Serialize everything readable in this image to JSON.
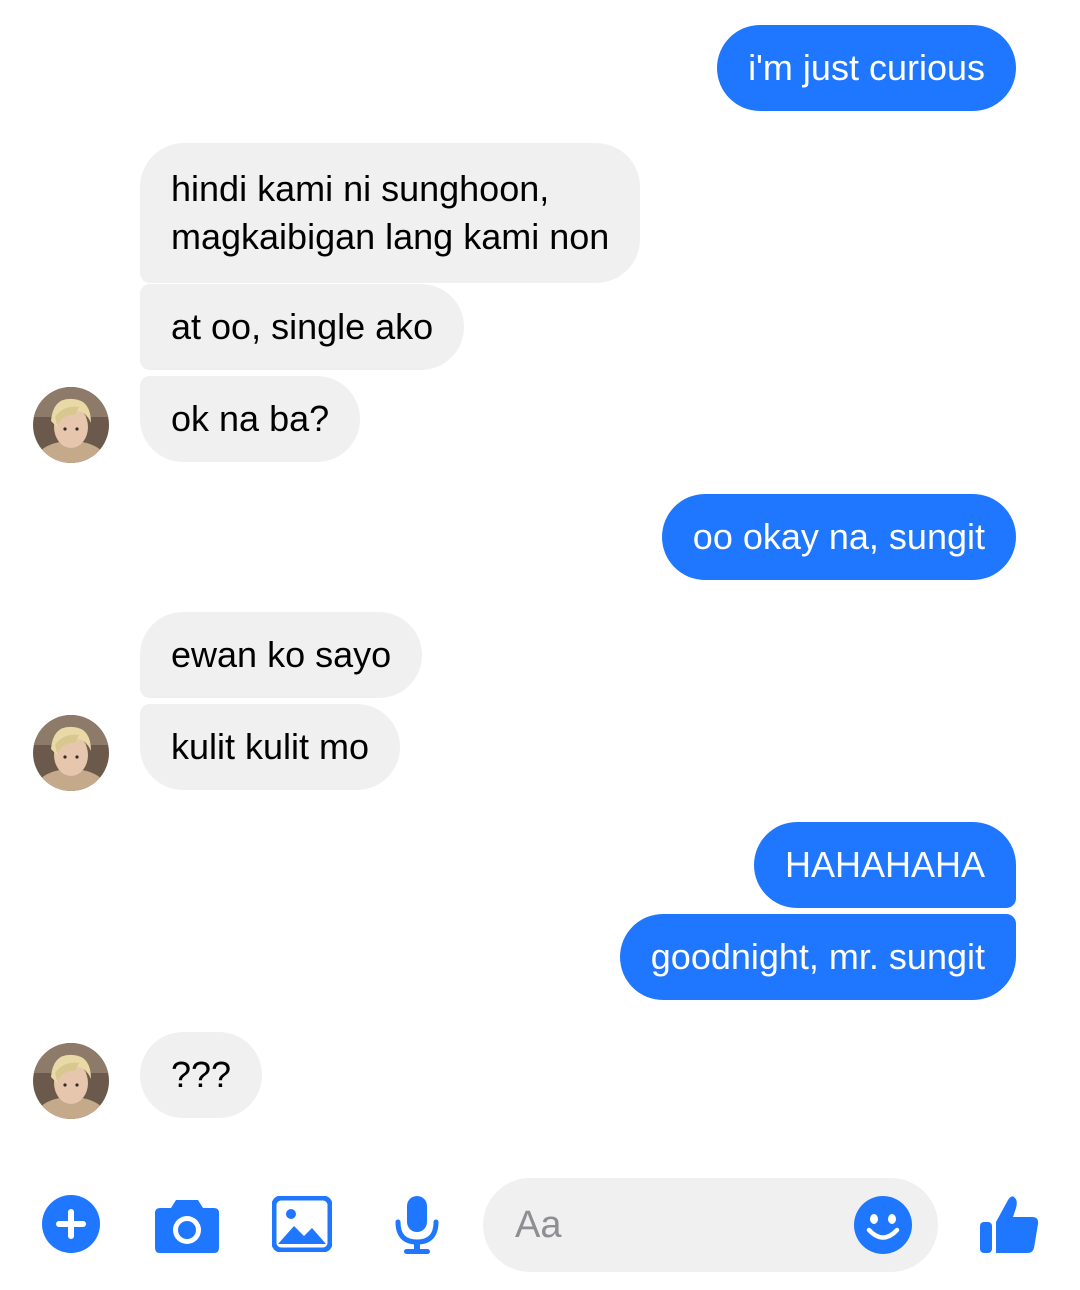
{
  "messages": [
    {
      "text": "i'm just curious",
      "from": "me"
    },
    {
      "lines": [
        "hindi kami ni sunghoon,",
        "magkaibigan lang kami non"
      ],
      "from": "them"
    },
    {
      "text": "at oo, single ako",
      "from": "them"
    },
    {
      "text": "ok na ba?",
      "from": "them"
    },
    {
      "text": "oo okay na, sungit",
      "from": "me"
    },
    {
      "text": "ewan ko sayo",
      "from": "them"
    },
    {
      "text": "kulit kulit mo",
      "from": "them"
    },
    {
      "text": "HAHAHAHA",
      "from": "me"
    },
    {
      "text": "goodnight, mr. sungit",
      "from": "me"
    },
    {
      "text": "???",
      "from": "them"
    }
  ],
  "composer": {
    "placeholder": "Aa",
    "value": ""
  },
  "toolbar": {
    "icons": [
      "plus-icon",
      "camera-icon",
      "gallery-icon",
      "microphone-icon",
      "emoji-icon",
      "thumbs-up-icon"
    ]
  },
  "colors": {
    "accent": "#1f76ff",
    "incoming_bubble": "#f0f0f0",
    "outgoing_bubble": "#1f76ff",
    "incoming_text": "#000000",
    "outgoing_text": "#ffffff",
    "composer_bg": "#f0f0f0"
  }
}
